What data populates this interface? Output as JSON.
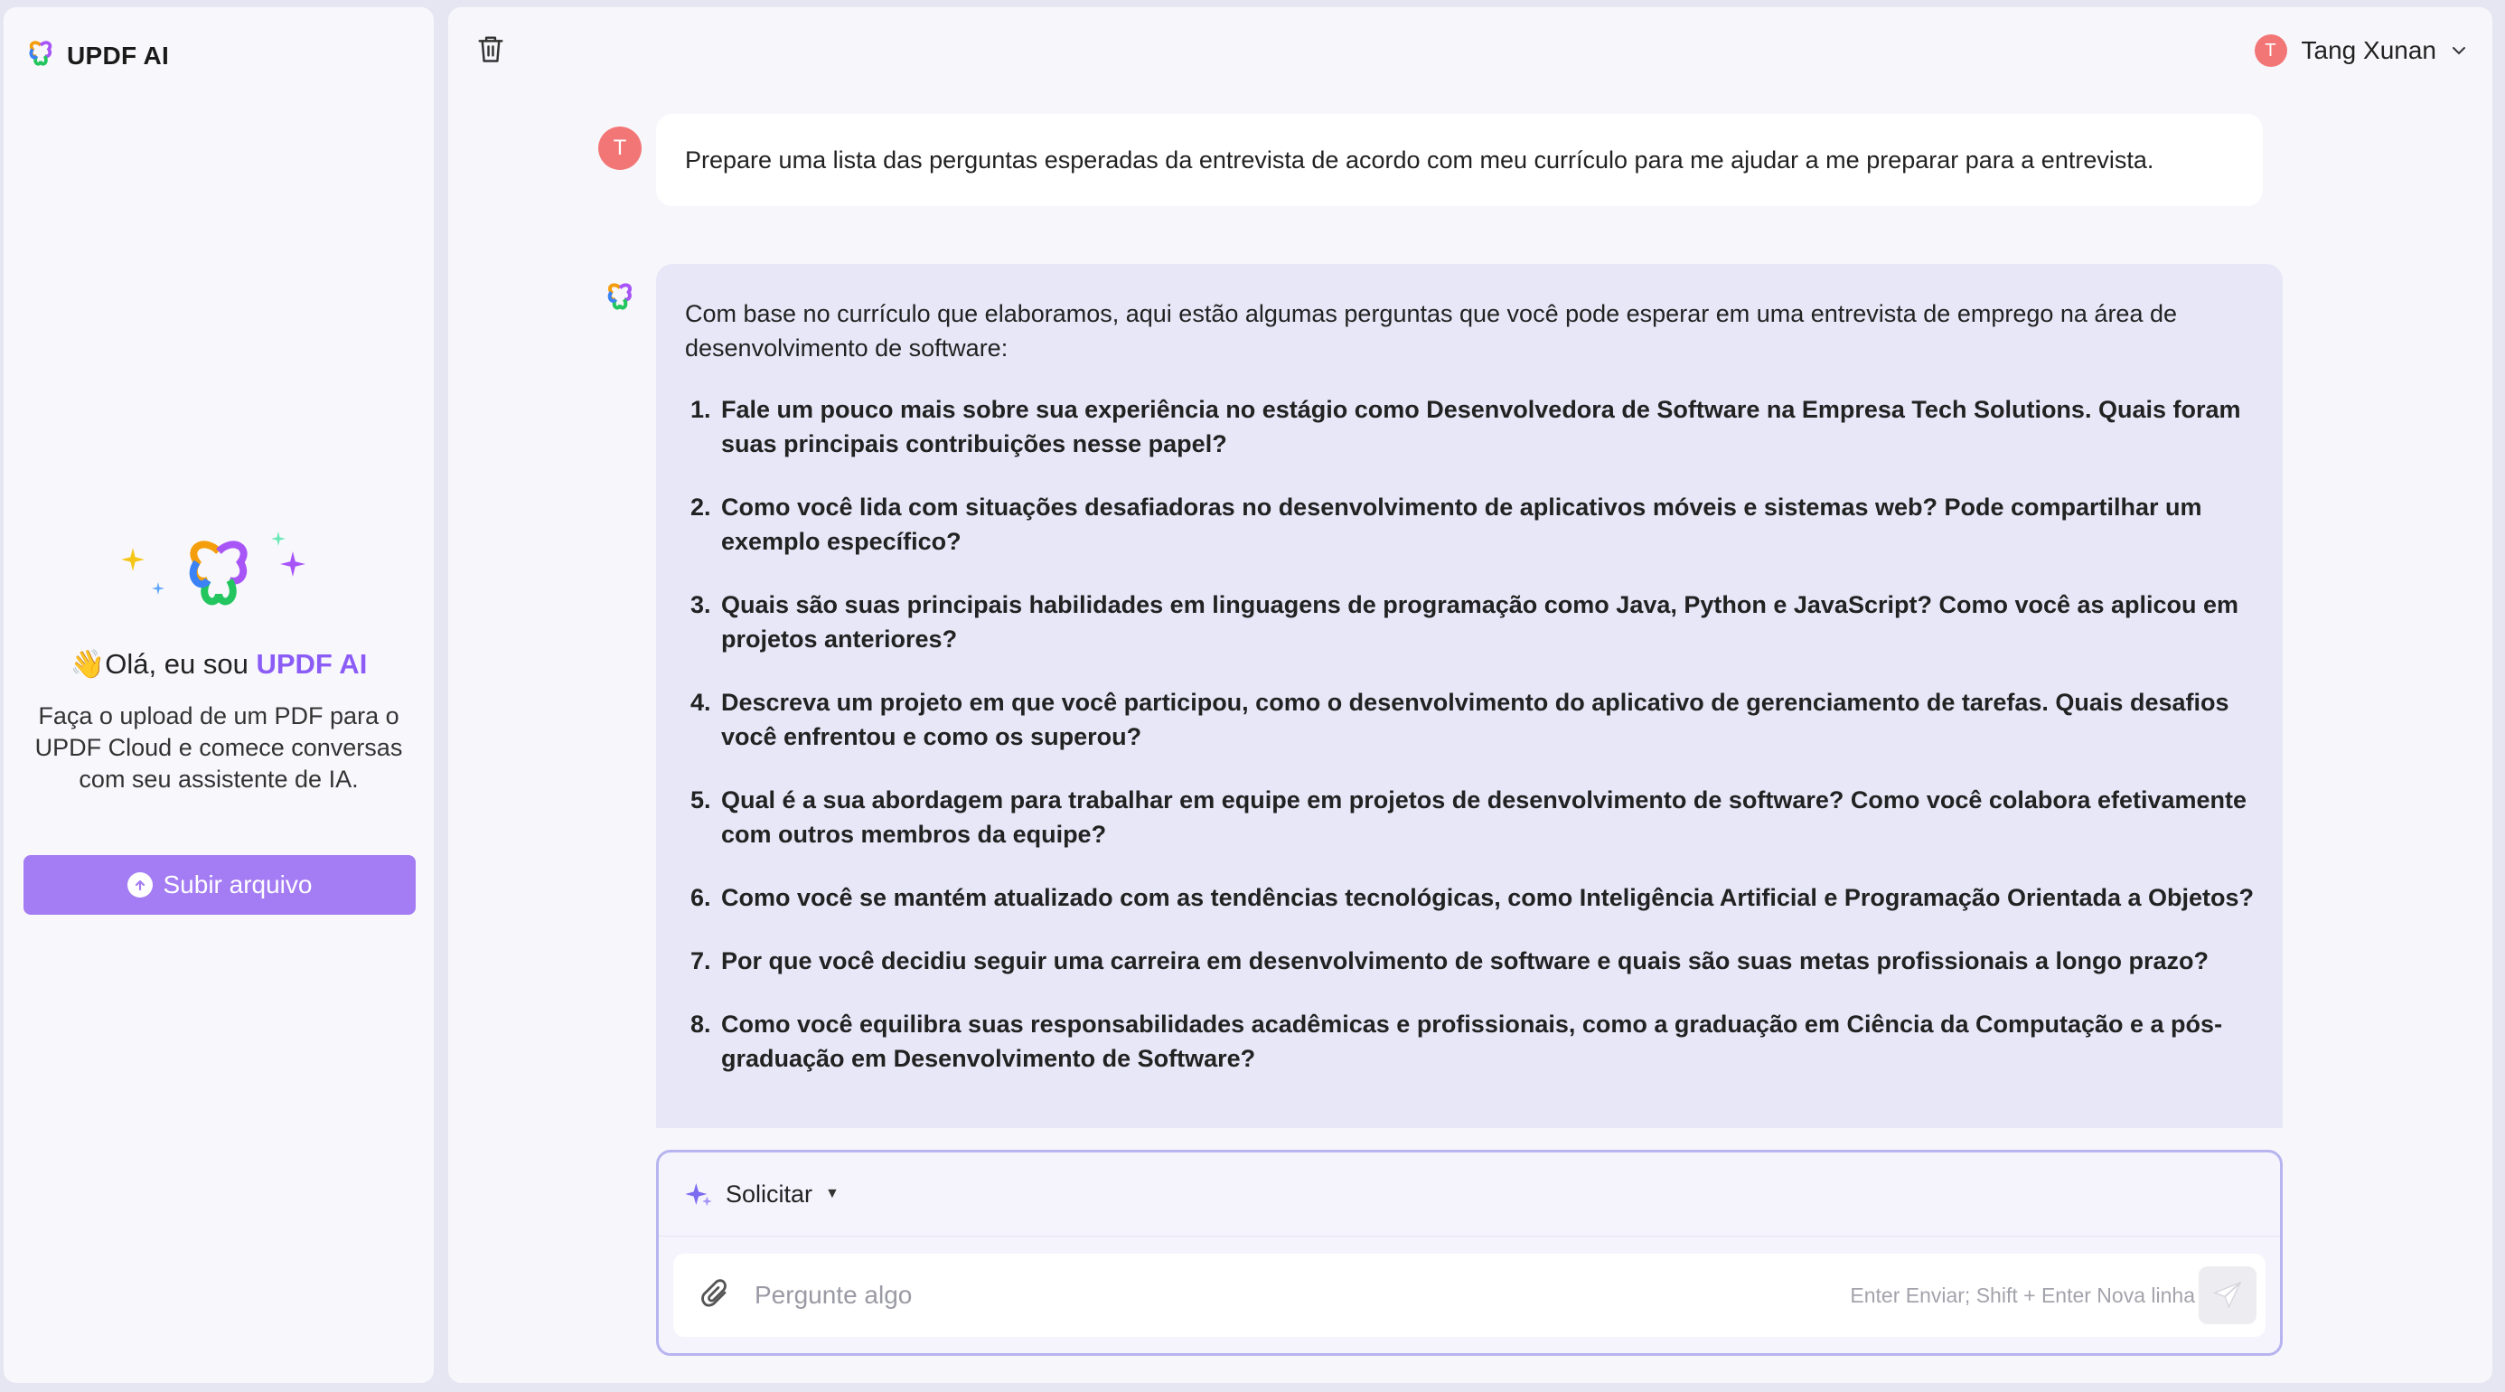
{
  "sidebar": {
    "brand": "UPDF AI",
    "greeting_wave": "👋",
    "greeting_prefix": "Olá, eu sou ",
    "greeting_accent": "UPDF AI",
    "description": "Faça o upload de um PDF para o UPDF Cloud e comece conversas com seu assistente de IA.",
    "upload_label": "Subir arquivo"
  },
  "header": {
    "user_initial": "T",
    "user_name": "Tang Xunan"
  },
  "chat": {
    "user_initial": "T",
    "user_message": "Prepare uma lista das perguntas esperadas da entrevista de acordo com meu currículo para me ajudar a me preparar para a entrevista.",
    "ai_intro": "Com base no currículo que elaboramos, aqui estão algumas perguntas que você pode esperar em uma entrevista de emprego na área de desenvolvimento de software:",
    "ai_items": [
      "Fale um pouco mais sobre sua experiência no estágio como Desenvolvedora de Software na Empresa Tech Solutions. Quais foram suas principais contribuições nesse papel?",
      "Como você lida com situações desafiadoras no desenvolvimento de aplicativos móveis e sistemas web? Pode compartilhar um exemplo específico?",
      "Quais são suas principais habilidades em linguagens de programação como Java, Python e JavaScript? Como você as aplicou em projetos anteriores?",
      "Descreva um projeto em que você participou, como o desenvolvimento do aplicativo de gerenciamento de tarefas. Quais desafios você enfrentou e como os superou?",
      "Qual é a sua abordagem para trabalhar em equipe em projetos de desenvolvimento de software? Como você colabora efetivamente com outros membros da equipe?",
      "Como você se mantém atualizado com as tendências tecnológicas, como Inteligência Artificial e Programação Orientada a Objetos?",
      "Por que você decidiu seguir uma carreira em desenvolvimento de software e quais são suas metas profissionais a longo prazo?",
      "Como você equilibra suas responsabilidades acadêmicas e profissionais, como a graduação em Ciência da Computação e a pós-graduação em Desenvolvimento de Software?"
    ]
  },
  "composer": {
    "prompt_label": "Solicitar",
    "caret": "▼",
    "placeholder": "Pergunte algo",
    "hint": "Enter Enviar; Shift + Enter Nova linha"
  },
  "colors": {
    "accent": "#8b5cf6",
    "button": "#a47cf3",
    "avatar": "#f37676",
    "ai_bubble": "#e8e7f8"
  },
  "icons": [
    "updf-logo-icon",
    "sparkle-icon",
    "upload-arrow-icon",
    "trash-icon",
    "chevron-down-icon",
    "paperclip-icon",
    "send-icon"
  ]
}
